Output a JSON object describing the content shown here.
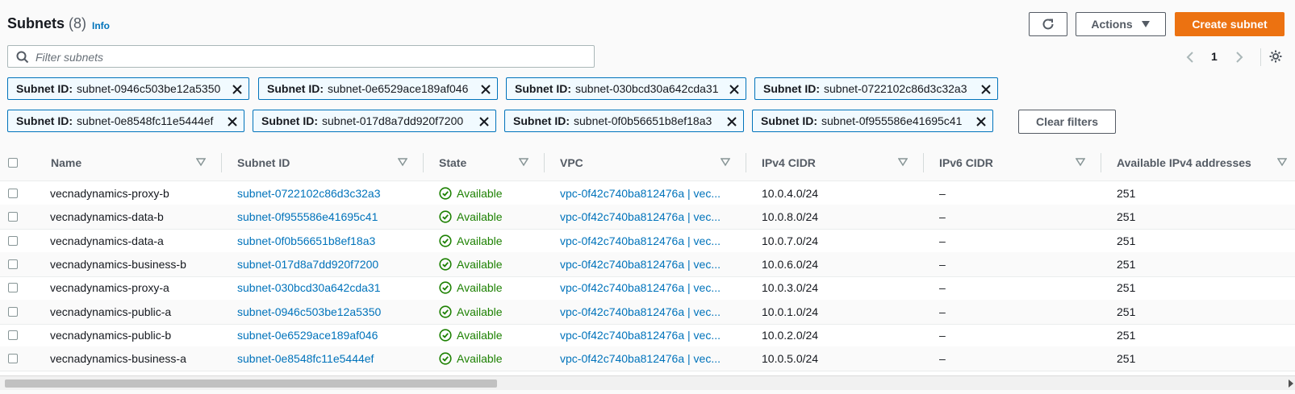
{
  "header": {
    "title": "Subnets",
    "count": "(8)",
    "info": "Info",
    "actions_label": "Actions",
    "create_label": "Create subnet",
    "refresh_icon": "refresh-icon",
    "settings_icon": "gear-icon"
  },
  "search": {
    "placeholder": "Filter subnets"
  },
  "pagination": {
    "page": "1"
  },
  "filters": [
    {
      "key": "Subnet ID:",
      "value": "subnet-0946c503be12a5350"
    },
    {
      "key": "Subnet ID:",
      "value": "subnet-0e6529ace189af046"
    },
    {
      "key": "Subnet ID:",
      "value": "subnet-030bcd30a642cda31"
    },
    {
      "key": "Subnet ID:",
      "value": "subnet-0722102c86d3c32a3"
    },
    {
      "key": "Subnet ID:",
      "value": "subnet-0e8548fc11e5444ef"
    },
    {
      "key": "Subnet ID:",
      "value": "subnet-017d8a7dd920f7200"
    },
    {
      "key": "Subnet ID:",
      "value": "subnet-0f0b56651b8ef18a3"
    },
    {
      "key": "Subnet ID:",
      "value": "subnet-0f955586e41695c41"
    }
  ],
  "clear_filters": "Clear filters",
  "columns": {
    "name": "Name",
    "subnet_id": "Subnet ID",
    "state": "State",
    "vpc": "VPC",
    "ipv4": "IPv4 CIDR",
    "ipv6": "IPv6 CIDR",
    "available": "Available IPv4 addresses"
  },
  "rows": [
    {
      "name": "vecnadynamics-proxy-b",
      "subnet_id": "subnet-0722102c86d3c32a3",
      "state": "Available",
      "vpc": "vpc-0f42c740ba812476a | vec...",
      "ipv4": "10.0.4.0/24",
      "ipv6": "–",
      "available": "251"
    },
    {
      "name": "vecnadynamics-data-b",
      "subnet_id": "subnet-0f955586e41695c41",
      "state": "Available",
      "vpc": "vpc-0f42c740ba812476a | vec...",
      "ipv4": "10.0.8.0/24",
      "ipv6": "–",
      "available": "251"
    },
    {
      "name": "vecnadynamics-data-a",
      "subnet_id": "subnet-0f0b56651b8ef18a3",
      "state": "Available",
      "vpc": "vpc-0f42c740ba812476a | vec...",
      "ipv4": "10.0.7.0/24",
      "ipv6": "–",
      "available": "251"
    },
    {
      "name": "vecnadynamics-business-b",
      "subnet_id": "subnet-017d8a7dd920f7200",
      "state": "Available",
      "vpc": "vpc-0f42c740ba812476a | vec...",
      "ipv4": "10.0.6.0/24",
      "ipv6": "–",
      "available": "251"
    },
    {
      "name": "vecnadynamics-proxy-a",
      "subnet_id": "subnet-030bcd30a642cda31",
      "state": "Available",
      "vpc": "vpc-0f42c740ba812476a | vec...",
      "ipv4": "10.0.3.0/24",
      "ipv6": "–",
      "available": "251"
    },
    {
      "name": "vecnadynamics-public-a",
      "subnet_id": "subnet-0946c503be12a5350",
      "state": "Available",
      "vpc": "vpc-0f42c740ba812476a | vec...",
      "ipv4": "10.0.1.0/24",
      "ipv6": "–",
      "available": "251"
    },
    {
      "name": "vecnadynamics-public-b",
      "subnet_id": "subnet-0e6529ace189af046",
      "state": "Available",
      "vpc": "vpc-0f42c740ba812476a | vec...",
      "ipv4": "10.0.2.0/24",
      "ipv6": "–",
      "available": "251"
    },
    {
      "name": "vecnadynamics-business-a",
      "subnet_id": "subnet-0e8548fc11e5444ef",
      "state": "Available",
      "vpc": "vpc-0f42c740ba812476a | vec...",
      "ipv4": "10.0.5.0/24",
      "ipv6": "–",
      "available": "251"
    }
  ],
  "colors": {
    "primary": "#ec7211",
    "link": "#0073bb",
    "success": "#1d8102"
  }
}
